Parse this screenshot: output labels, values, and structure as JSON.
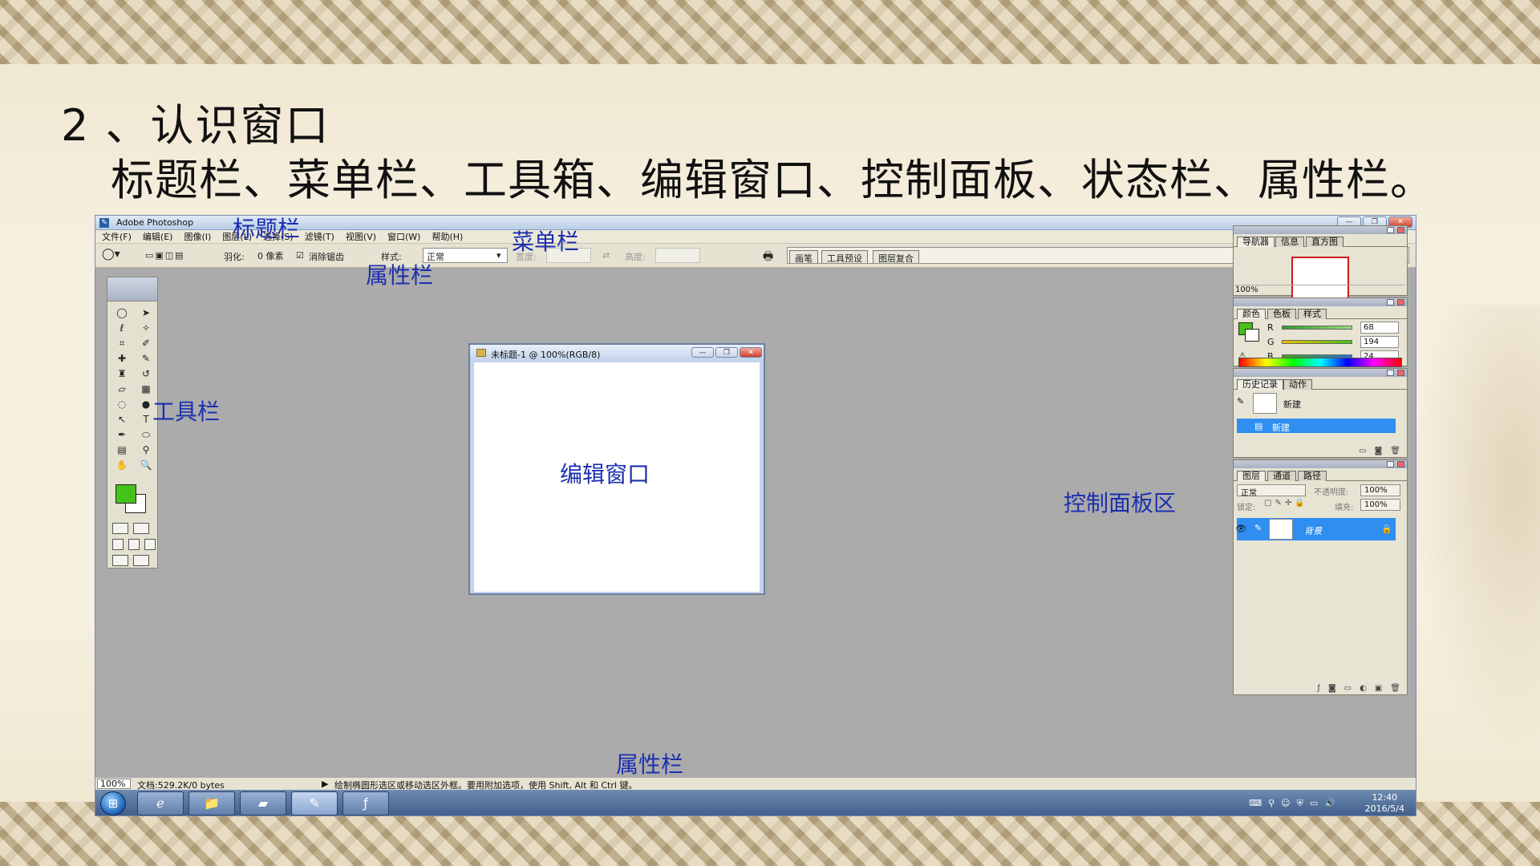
{
  "slide": {
    "title": "2 、认识窗口",
    "subtitle": "标题栏、菜单栏、工具箱、编辑窗口、控制面板、状态栏、属性栏。"
  },
  "window": {
    "title": "Adobe Photoshop",
    "controls": {
      "minimize": "—",
      "restore": "❐",
      "close": "✕"
    }
  },
  "menu": [
    "文件(F)",
    "编辑(E)",
    "图像(I)",
    "图层(L)",
    "选择(S)",
    "滤镜(T)",
    "视图(V)",
    "窗口(W)",
    "帮助(H)"
  ],
  "options_bar": {
    "feather_label": "羽化:",
    "feather_value": "0 像素",
    "antialias_label": "消除锯齿",
    "style_label": "样式:",
    "style_value": "正常",
    "width_label": "宽度:",
    "height_label": "高度:",
    "well_tabs": [
      "画笔",
      "工具预设",
      "图层复合"
    ]
  },
  "document": {
    "title": "未标题-1 @ 100%(RGB/8)"
  },
  "panels": {
    "navigator": {
      "tabs": [
        "导航器",
        "信息",
        "直方图"
      ],
      "zoom": "100%"
    },
    "color": {
      "tabs": [
        "颜色",
        "色板",
        "样式"
      ],
      "channels": [
        {
          "label": "R",
          "value": "68"
        },
        {
          "label": "G",
          "value": "194"
        },
        {
          "label": "B",
          "value": "24"
        }
      ],
      "foreground": "#44c218"
    },
    "history": {
      "tabs": [
        "历史记录",
        "动作"
      ],
      "snapshot_label": "新建",
      "selected_state": "新建"
    },
    "layers": {
      "tabs": [
        "图层",
        "通道",
        "路径"
      ],
      "blend_mode": "正常",
      "opacity_label": "不透明度:",
      "opacity_value": "100%",
      "lock_label": "锁定:",
      "fill_label": "填充:",
      "fill_value": "100%",
      "layer_name": "背景"
    }
  },
  "status_bar": {
    "zoom": "100%",
    "doc_info": "文档:529.2K/0 bytes",
    "hint": "绘制椭圆形选区或移动选区外框。要用附加选项，使用 Shift, Alt 和 Ctrl 键。"
  },
  "taskbar": {
    "time": "12:40",
    "date": "2016/5/4"
  },
  "annotations": {
    "title_bar": "标题栏",
    "menu_bar": "菜单栏",
    "options_bar": "属性栏",
    "toolbox": "工具栏",
    "edit_window": "编辑窗口",
    "control_panel": "控制面板区",
    "status_bar": "属性栏"
  },
  "colors": {
    "annotation": "#1c2fb0",
    "selection": "#2f8ef0",
    "foreground_swatch": "#44c218"
  }
}
